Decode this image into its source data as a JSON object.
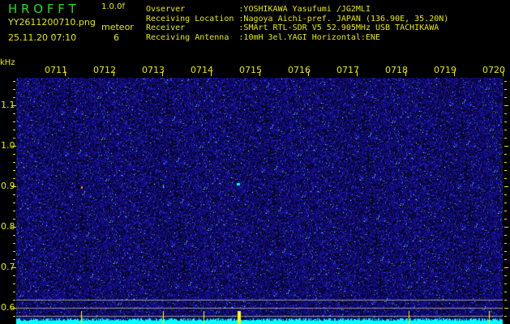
{
  "header": {
    "app_title": "H R O F F T",
    "version": "1.0.0f",
    "filename": "YY2611200710.png",
    "datetime": "25.11.20 07:10",
    "meteor_label": "meteor",
    "meteor_count": "6"
  },
  "info": [
    {
      "label": "Ovserver          ",
      "value": ":YOSHIKAWA Yasufumi /JG2MLI"
    },
    {
      "label": "Receiving Location",
      "value": ":Nagoya Aichi-pref. JAPAN (136.90E, 35.20N)"
    },
    {
      "label": "Receiver          ",
      "value": ":SMArt RTL-SDR V5 52.905MHz USB TACHIKAWA"
    },
    {
      "label": "Receiving Antenna ",
      "value": ":10mH 3el.YAGI Horizontal:ENE"
    }
  ],
  "axis": {
    "y_unit": "kHz",
    "y_labels": [
      "1.1",
      "1.0",
      "0.9",
      "0.8",
      "0.7",
      "0.6"
    ],
    "time_labels": [
      "0711",
      "0712",
      "0713",
      "0714",
      "0715",
      "0716",
      "0717",
      "0718",
      "0719",
      "0720"
    ]
  },
  "colors": {
    "text": "#e8e800",
    "title": "#22dd22",
    "signal": "#00ffff",
    "noise": "#1a1ab0"
  }
}
